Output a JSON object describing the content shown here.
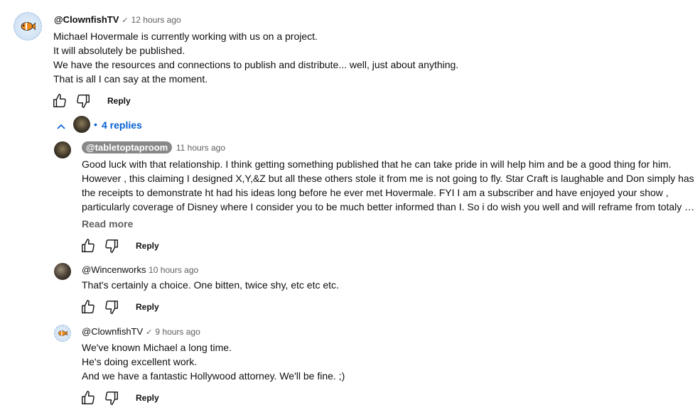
{
  "top_comment": {
    "author": "@ClownfishTV",
    "time": "12 hours ago",
    "lines": [
      "Michael Hovermale is currently working with us on a project.",
      "It will absolutely be published.",
      "We have the resources and connections to publish and distribute... well, just about anything.",
      "That is all I can say at the moment."
    ],
    "reply_label": "Reply"
  },
  "replies_toggle": {
    "count_label": "4 replies"
  },
  "replies": [
    {
      "author": "@tabletoptaproom",
      "time": "11 hours ago",
      "lines": [
        "Good  luck with that relationship. I think getting something published that he can take pride in will help him and be a good thing for him.",
        "However , this claiming I designed X,Y,&Z but all these others stole it from me is not going to fly. Star Craft is laughable and Don simply has",
        "the receipts to demonstrate ht had his ideas long before he ever met Hovermale. FYI I am a subscriber and have enjoyed your show ,",
        "particularly coverage of Disney where I consider you to be much better informed than I. So i do wish you well and will reframe from totaly …"
      ],
      "read_more": "Read more",
      "reply_label": "Reply"
    },
    {
      "author": "@Wincenworks",
      "time": "10 hours ago",
      "lines": [
        "That's certainly a choice.  One bitten, twice shy, etc etc etc."
      ],
      "reply_label": "Reply"
    },
    {
      "author": "@ClownfishTV",
      "time": "9 hours ago",
      "lines": [
        "We've known Michael a long time.",
        "He's doing excellent work.",
        "And we have a fantastic Hollywood attorney. We'll be fine. ;)"
      ],
      "reply_label": "Reply"
    }
  ],
  "colors": {
    "link_blue": "#065fd4",
    "meta_gray": "#606060",
    "chip_gray": "#888888"
  }
}
